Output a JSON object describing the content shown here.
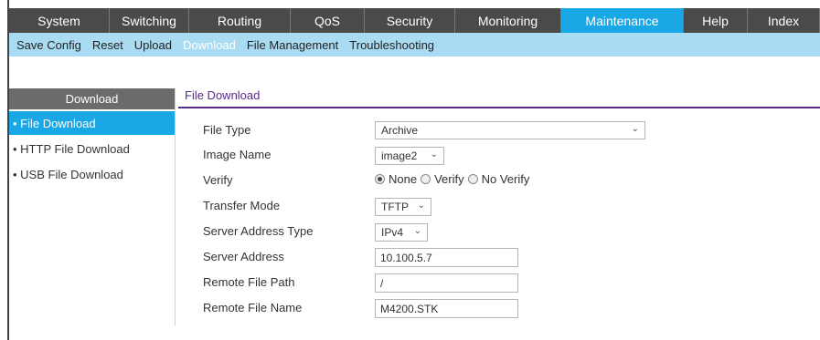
{
  "top_nav": [
    "System",
    "Switching",
    "Routing",
    "QoS",
    "Security",
    "Monitoring",
    "Maintenance",
    "Help",
    "Index"
  ],
  "sub_nav": [
    "Save Config",
    "Reset",
    "Upload",
    "Download",
    "File Management",
    "Troubleshooting"
  ],
  "sidebar": {
    "title": "Download",
    "items": [
      "File Download",
      "HTTP File Download",
      "USB File Download"
    ]
  },
  "content": {
    "title": "File Download",
    "fields": {
      "file_type_label": "File Type",
      "file_type_value": "Archive",
      "image_name_label": "Image Name",
      "image_name_value": "image2",
      "verify_label": "Verify",
      "verify_options": [
        "None",
        "Verify",
        "No Verify"
      ],
      "transfer_mode_label": "Transfer Mode",
      "transfer_mode_value": "TFTP",
      "server_address_type_label": "Server Address Type",
      "server_address_type_value": "IPv4",
      "server_address_label": "Server Address",
      "server_address_value": "10.100.5.7",
      "remote_file_path_label": "Remote File Path",
      "remote_file_path_value": "/",
      "remote_file_name_label": "Remote File Name",
      "remote_file_name_value": "M4200.STK"
    }
  },
  "colors": {
    "nav_bg": "#4a4a4a",
    "accent": "#1aa7e6",
    "subnav_bg": "#a9dcf3",
    "title_purple": "#5b2a8a"
  }
}
